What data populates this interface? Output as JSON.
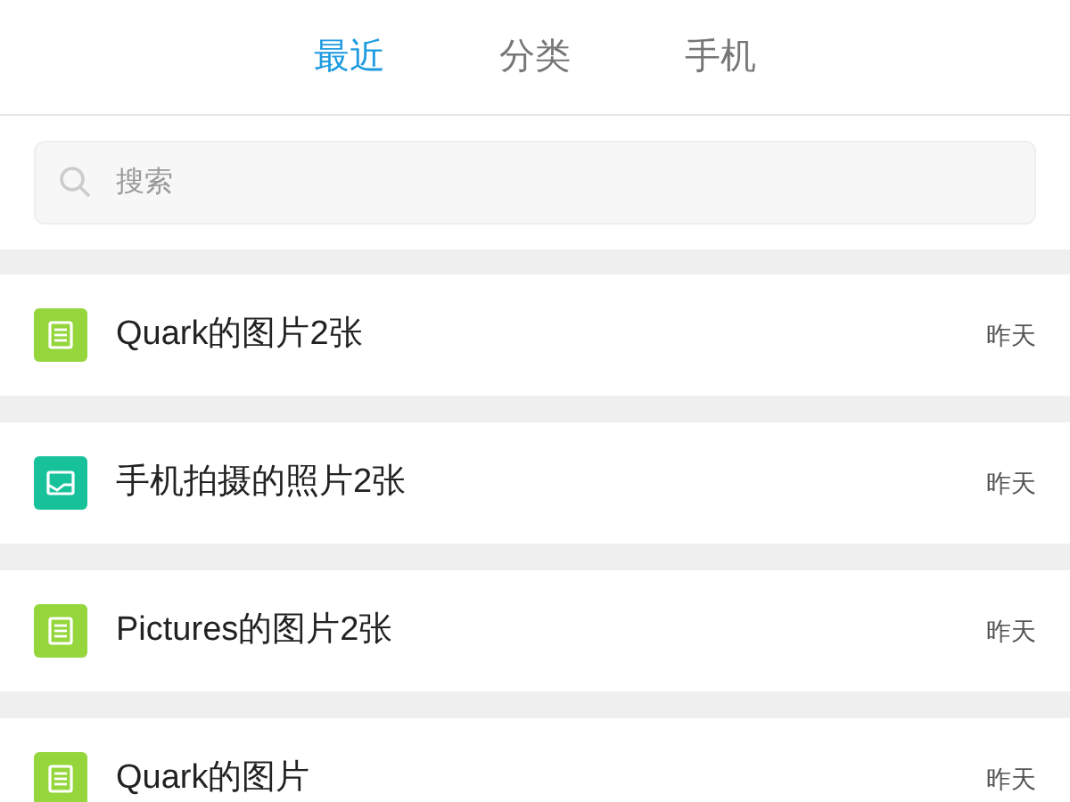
{
  "tabs": [
    {
      "label": "最近",
      "selected": true
    },
    {
      "label": "分类",
      "selected": false
    },
    {
      "label": "手机",
      "selected": false
    }
  ],
  "search": {
    "placeholder": "搜索"
  },
  "items": [
    {
      "kind": "document",
      "title": "Quark的图片2张",
      "time": "昨天"
    },
    {
      "kind": "photo",
      "title": "手机拍摄的照片2张",
      "time": "昨天"
    },
    {
      "kind": "document",
      "title": "Pictures的图片2张",
      "time": "昨天"
    },
    {
      "kind": "document",
      "title": "Quark的图片",
      "time": "昨天"
    }
  ]
}
